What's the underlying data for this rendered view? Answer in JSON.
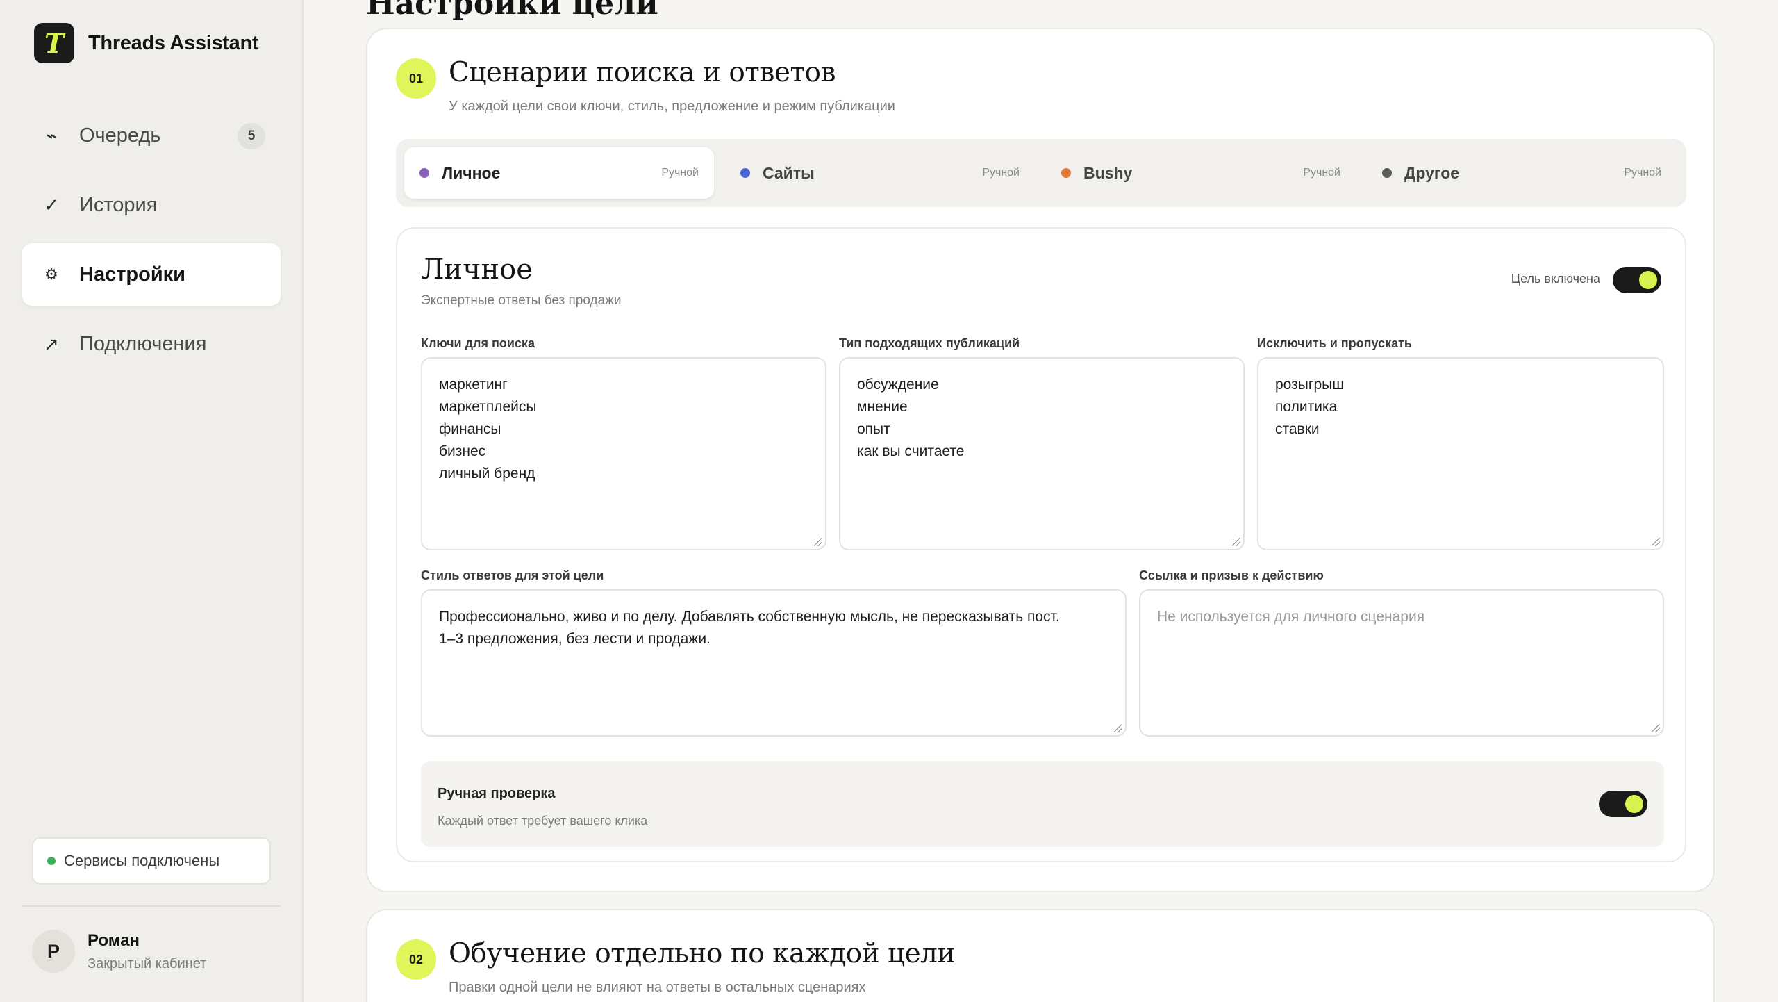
{
  "app": {
    "name": "Threads Assistant",
    "logo_letter": "T"
  },
  "sidebar": {
    "items": [
      {
        "label": "Очередь",
        "icon": "wave-icon",
        "badge": "5",
        "active": false
      },
      {
        "label": "История",
        "icon": "check-icon",
        "active": false
      },
      {
        "label": "Настройки",
        "icon": "gear-icon",
        "active": true
      },
      {
        "label": "Подключения",
        "icon": "arrow-up-right-icon",
        "active": false
      }
    ],
    "status": "Сервисы подключены",
    "user": {
      "initial": "Р",
      "name": "Роман",
      "role": "Закрытый кабинет"
    }
  },
  "page": {
    "title": "Настройки цели"
  },
  "section1": {
    "step": "01",
    "title": "Сценарии поиска и ответов",
    "subtitle": "У каждой цели свои ключи, стиль, предложение и режим публикации",
    "tabs": [
      {
        "label": "Личное",
        "mode": "Ручной",
        "color": "#8a5fb8"
      },
      {
        "label": "Сайты",
        "mode": "Ручной",
        "color": "#4a66d6"
      },
      {
        "label": "Bushy",
        "mode": "Ручной",
        "color": "#e0793a"
      },
      {
        "label": "Другое",
        "mode": "Ручной",
        "color": "#5a5a5a"
      }
    ],
    "goal": {
      "title": "Личное",
      "subtitle": "Экспертные ответы без продажи",
      "enabled_label": "Цель включена",
      "enabled": true,
      "keys_label": "Ключи для поиска",
      "keys_value": "маркетинг\nмаркетплейсы\nфинансы\nбизнес\nличный бренд",
      "types_label": "Тип подходящих публикаций",
      "types_value": "обсуждение\nмнение\nопыт\nкак вы считаете",
      "exclude_label": "Исключить и пропускать",
      "exclude_value": "розыгрыш\nполитика\nставки",
      "style_label": "Стиль ответов для этой цели",
      "style_value": "Профессионально, живо и по делу. Добавлять собственную мысль, не пересказывать пост.\n1–3 предложения, без лести и продажи.",
      "link_label": "Ссылка и призыв к действию",
      "link_placeholder": "Не используется для личного сценария",
      "manual_title": "Ручная проверка",
      "manual_sub": "Каждый ответ требует вашего клика",
      "manual_enabled": true
    }
  },
  "section2": {
    "step": "02",
    "title": "Обучение отдельно по каждой цели",
    "subtitle": "Правки одной цели не влияют на ответы в остальных сценариях"
  }
}
